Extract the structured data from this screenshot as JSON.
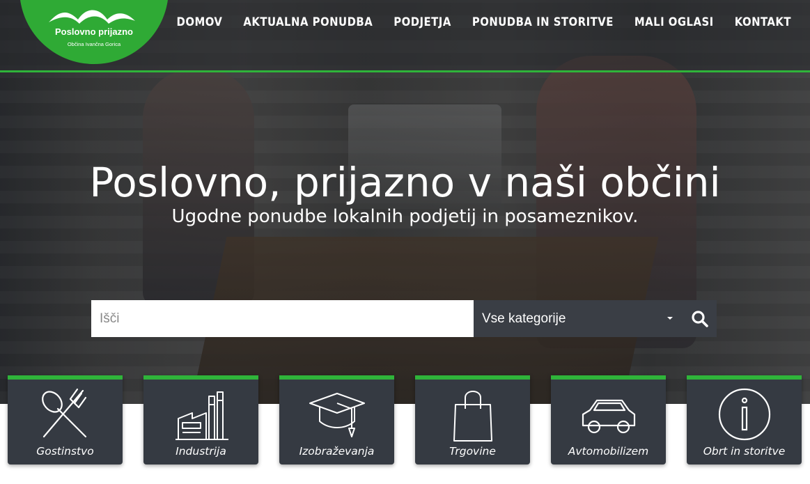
{
  "brand": {
    "title": "Poslovno prijazno",
    "subtitle": "Občina Ivančna Gorica",
    "color": "#2faa35"
  },
  "nav": {
    "items": [
      "DOMOV",
      "AKTUALNA PONUDBA",
      "PODJETJA",
      "PONUDBA IN STORITVE",
      "MALI OGLASI",
      "KONTAKT"
    ]
  },
  "hero": {
    "headline": "Poslovno, prijazno v naši občini",
    "subline": "Ugodne ponudbe lokalnih podjetij in posameznikov."
  },
  "search": {
    "placeholder": "Išči",
    "category_selected": "Vse kategorije",
    "button_icon": "search-icon"
  },
  "categories": [
    {
      "label": "Gostinstvo",
      "icon": "fork-spoon-icon"
    },
    {
      "label": "Industrija",
      "icon": "factory-icon"
    },
    {
      "label": "Izobraževanja",
      "icon": "graduation-cap-icon"
    },
    {
      "label": "Trgovine",
      "icon": "shopping-bag-icon"
    },
    {
      "label": "Avtomobilizem",
      "icon": "car-icon"
    },
    {
      "label": "Obrt in storitve",
      "icon": "info-icon"
    }
  ],
  "colors": {
    "accent": "#2fb43a",
    "card_bg": "#353a42",
    "select_bg": "#3a3e45"
  }
}
